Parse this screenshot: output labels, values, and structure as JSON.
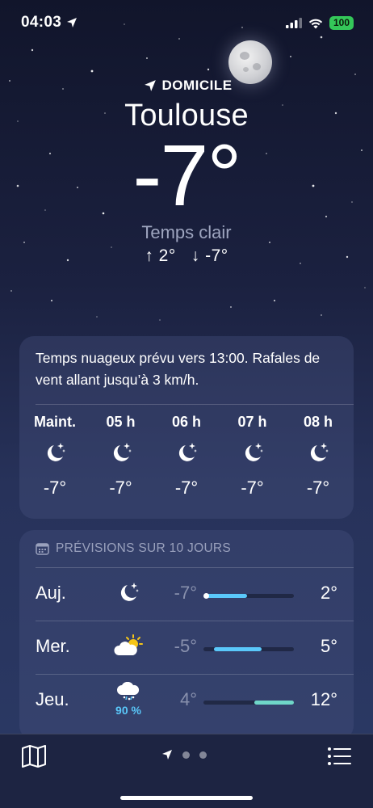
{
  "status_bar": {
    "time": "04:03",
    "battery": "100"
  },
  "location": {
    "label": "DOMICILE",
    "city": "Toulouse",
    "temperature": "-7°",
    "condition": "Temps clair",
    "high": "↑ 2°",
    "low": "↓ -7°"
  },
  "hourly": {
    "summary": "Temps nuageux prévu vers 13:00. Rafales de vent allant jusqu’à 3 km/h.",
    "items": [
      {
        "label": "Maint.",
        "icon": "moon-stars-icon",
        "temp": "-7°"
      },
      {
        "label": "05 h",
        "icon": "moon-stars-icon",
        "temp": "-7°"
      },
      {
        "label": "06 h",
        "icon": "moon-stars-icon",
        "temp": "-7°"
      },
      {
        "label": "07 h",
        "icon": "moon-stars-icon",
        "temp": "-7°"
      },
      {
        "label": "08 h",
        "icon": "moon-stars-icon",
        "temp": "-7°"
      }
    ]
  },
  "forecast": {
    "title": "PRÉVISIONS SUR 10 JOURS",
    "days": [
      {
        "day": "Auj.",
        "icon": "moon-stars-icon",
        "low": "-7°",
        "high": "2°",
        "range_start": 0.03,
        "range_end": 0.48,
        "color": "#5ac8fa",
        "current": true
      },
      {
        "day": "Mer.",
        "icon": "sun-cloud-icon",
        "low": "-5°",
        "high": "5°",
        "range_start": 0.12,
        "range_end": 0.64,
        "color": "#5ac8fa"
      },
      {
        "day": "Jeu.",
        "icon": "cloud-snow-icon",
        "precip": "90 %",
        "low": "4°",
        "high": "12°",
        "range_start": 0.56,
        "range_end": 1.0,
        "color": "#6fd6c8"
      }
    ]
  },
  "tabbar": {
    "map_icon": "map-icon",
    "list_icon": "list-icon",
    "page_indicators": [
      "location-arrow-icon",
      "dot",
      "dot"
    ]
  },
  "colors": {
    "accent_blue": "#5ac8fa",
    "battery_green": "#34c759"
  }
}
